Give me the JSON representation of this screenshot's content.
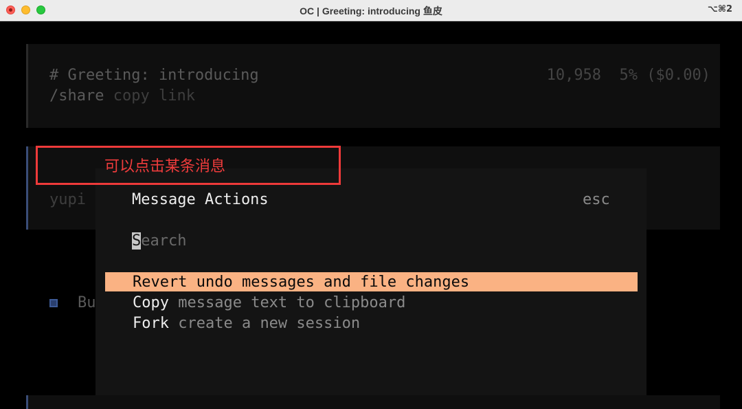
{
  "window": {
    "title": "OC | Greeting: introducing 鱼皮",
    "shortcut": "⌥⌘2"
  },
  "session_header": {
    "title": "# Greeting: introducing",
    "stats": "10,958  5% ($0.00)",
    "share_cmd": "/share",
    "share_hint": "copy link"
  },
  "user_message": {
    "author": "yupi"
  },
  "background_line": {
    "icon": "square-icon",
    "partial_text": "Bu"
  },
  "annotation": {
    "text": "可以点击某条消息",
    "color": "#ee3a3a"
  },
  "dialog": {
    "title": "Message Actions",
    "close_hint": "esc",
    "search_placeholder": "Search",
    "search_cursor_char": "S",
    "search_rest": "earch",
    "accent": "#fab283",
    "actions": [
      {
        "name": "Revert",
        "description": "undo messages and file changes",
        "selected": true
      },
      {
        "name": "Copy",
        "description": "message text to clipboard",
        "selected": false
      },
      {
        "name": "Fork",
        "description": "create a new session",
        "selected": false
      }
    ]
  }
}
